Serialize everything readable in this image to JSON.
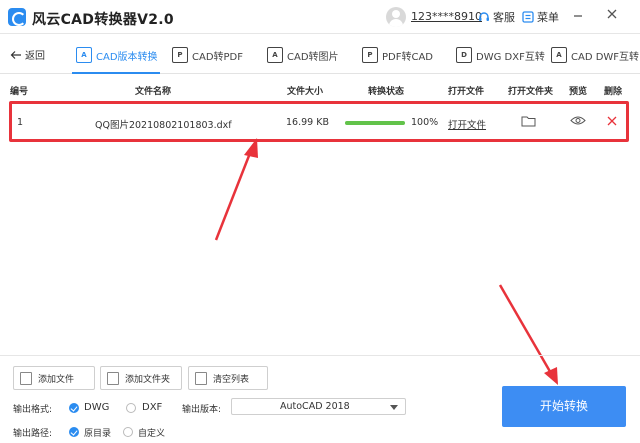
{
  "app": {
    "title": "风云CAD转换器V2.0"
  },
  "header": {
    "user": "123****8910",
    "service_label": "客服",
    "menu_label": "菜单"
  },
  "nav": {
    "back_label": "返回",
    "tabs": [
      {
        "label": "CAD版本转换",
        "icon_text": "A",
        "active": true
      },
      {
        "label": "CAD转PDF",
        "icon_text": "P",
        "active": false
      },
      {
        "label": "CAD转图片",
        "icon_text": "A",
        "active": false
      },
      {
        "label": "PDF转CAD",
        "icon_text": "P",
        "active": false
      },
      {
        "label": "DWG DXF互转",
        "icon_text": "D",
        "active": false
      },
      {
        "label": "CAD DWF互转",
        "icon_text": "A",
        "active": false
      }
    ]
  },
  "table": {
    "headers": [
      "编号",
      "文件名称",
      "文件大小",
      "转换状态",
      "打开文件",
      "打开文件夹",
      "预览",
      "删除"
    ],
    "rows": [
      {
        "index": "1",
        "name": "QQ图片20210802101803.dxf",
        "size": "16.99 KB",
        "progress": 100,
        "progress_text": "100%",
        "open_file": "打开文件"
      }
    ]
  },
  "toolbar": {
    "add_file": "添加文件",
    "add_folder": "添加文件夹",
    "clear_list": "清空列表"
  },
  "options": {
    "format_label": "输出格式:",
    "format_dwg": "DWG",
    "format_dxf": "DXF",
    "format_selected": "DWG",
    "version_label": "输出版本:",
    "version_value": "AutoCAD 2018",
    "path_label": "输出路径:",
    "path_original": "原目录",
    "path_custom": "自定义",
    "path_selected": "原目录"
  },
  "start_button": "开始转换",
  "colors": {
    "accent": "#2b8cf0",
    "highlight": "#e8333b",
    "progress": "#62c34a"
  }
}
